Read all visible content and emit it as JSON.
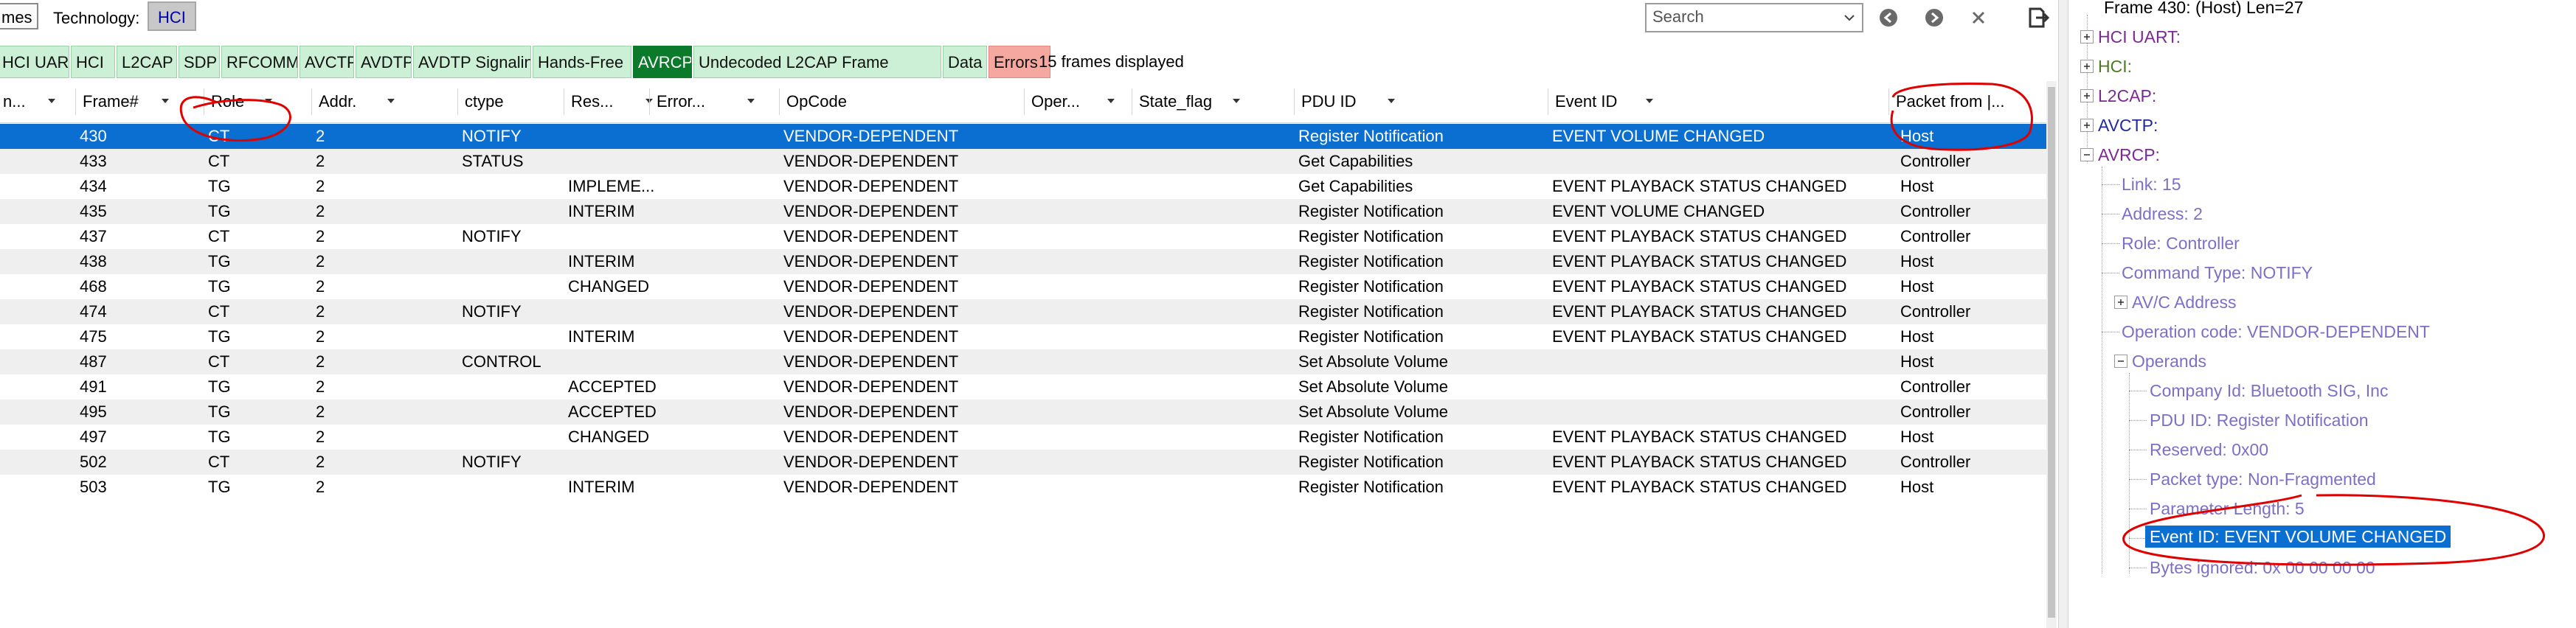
{
  "toolbar": {
    "frames_button": "mes",
    "technology_label": "Technology:",
    "technology_value": "HCI",
    "search_placeholder": "Search",
    "icons": [
      "back-arrow-icon",
      "forward-arrow-icon",
      "close-icon",
      "export-icon"
    ]
  },
  "filter_tabs": {
    "tabs": [
      "HCI UART",
      "HCI",
      "L2CAP",
      "SDP",
      "RFCOMM",
      "AVCTP",
      "AVDTP",
      "AVDTP Signaling",
      "Hands-Free",
      "AVRCP",
      "Undecoded L2CAP Frame",
      "Data",
      "Errors"
    ],
    "active_tab": "AVRCP",
    "frames_displayed": "15 frames displayed"
  },
  "table": {
    "columns": [
      "n...",
      "Frame#",
      "Role",
      "Addr.",
      "ctype",
      "Res...",
      "Error...",
      "OpCode",
      "Oper...",
      "State_flag",
      "PDU ID",
      "Event ID",
      "Packet from |..."
    ],
    "selected_frame": "430",
    "rows": [
      {
        "frame": "430",
        "role": "CT",
        "addr": "2",
        "ctype": "NOTIFY",
        "res": "",
        "opcode": "VENDOR-DEPENDENT",
        "pdu": "Register Notification",
        "event": "EVENT VOLUME CHANGED",
        "from": "Host"
      },
      {
        "frame": "433",
        "role": "CT",
        "addr": "2",
        "ctype": "STATUS",
        "res": "",
        "opcode": "VENDOR-DEPENDENT",
        "pdu": "Get Capabilities",
        "event": "",
        "from": "Controller"
      },
      {
        "frame": "434",
        "role": "TG",
        "addr": "2",
        "ctype": "",
        "res": "IMPLEME...",
        "opcode": "VENDOR-DEPENDENT",
        "pdu": "Get Capabilities",
        "event": "EVENT PLAYBACK STATUS CHANGED",
        "from": "Host"
      },
      {
        "frame": "435",
        "role": "TG",
        "addr": "2",
        "ctype": "",
        "res": "INTERIM",
        "opcode": "VENDOR-DEPENDENT",
        "pdu": "Register Notification",
        "event": "EVENT VOLUME CHANGED",
        "from": "Controller"
      },
      {
        "frame": "437",
        "role": "CT",
        "addr": "2",
        "ctype": "NOTIFY",
        "res": "",
        "opcode": "VENDOR-DEPENDENT",
        "pdu": "Register Notification",
        "event": "EVENT PLAYBACK STATUS CHANGED",
        "from": "Controller"
      },
      {
        "frame": "438",
        "role": "TG",
        "addr": "2",
        "ctype": "",
        "res": "INTERIM",
        "opcode": "VENDOR-DEPENDENT",
        "pdu": "Register Notification",
        "event": "EVENT PLAYBACK STATUS CHANGED",
        "from": "Host"
      },
      {
        "frame": "468",
        "role": "TG",
        "addr": "2",
        "ctype": "",
        "res": "CHANGED",
        "opcode": "VENDOR-DEPENDENT",
        "pdu": "Register Notification",
        "event": "EVENT PLAYBACK STATUS CHANGED",
        "from": "Host"
      },
      {
        "frame": "474",
        "role": "CT",
        "addr": "2",
        "ctype": "NOTIFY",
        "res": "",
        "opcode": "VENDOR-DEPENDENT",
        "pdu": "Register Notification",
        "event": "EVENT PLAYBACK STATUS CHANGED",
        "from": "Controller"
      },
      {
        "frame": "475",
        "role": "TG",
        "addr": "2",
        "ctype": "",
        "res": "INTERIM",
        "opcode": "VENDOR-DEPENDENT",
        "pdu": "Register Notification",
        "event": "EVENT PLAYBACK STATUS CHANGED",
        "from": "Host"
      },
      {
        "frame": "487",
        "role": "CT",
        "addr": "2",
        "ctype": "CONTROL",
        "res": "",
        "opcode": "VENDOR-DEPENDENT",
        "pdu": "Set Absolute Volume",
        "event": "",
        "from": "Host"
      },
      {
        "frame": "491",
        "role": "TG",
        "addr": "2",
        "ctype": "",
        "res": "ACCEPTED",
        "opcode": "VENDOR-DEPENDENT",
        "pdu": "Set Absolute Volume",
        "event": "",
        "from": "Controller"
      },
      {
        "frame": "495",
        "role": "TG",
        "addr": "2",
        "ctype": "",
        "res": "ACCEPTED",
        "opcode": "VENDOR-DEPENDENT",
        "pdu": "Set Absolute Volume",
        "event": "",
        "from": "Controller"
      },
      {
        "frame": "497",
        "role": "TG",
        "addr": "2",
        "ctype": "",
        "res": "CHANGED",
        "opcode": "VENDOR-DEPENDENT",
        "pdu": "Register Notification",
        "event": "EVENT PLAYBACK STATUS CHANGED",
        "from": "Host"
      },
      {
        "frame": "502",
        "role": "CT",
        "addr": "2",
        "ctype": "NOTIFY",
        "res": "",
        "opcode": "VENDOR-DEPENDENT",
        "pdu": "Register Notification",
        "event": "EVENT PLAYBACK STATUS CHANGED",
        "from": "Controller"
      },
      {
        "frame": "503",
        "role": "TG",
        "addr": "2",
        "ctype": "",
        "res": "INTERIM",
        "opcode": "VENDOR-DEPENDENT",
        "pdu": "Register Notification",
        "event": "EVENT PLAYBACK STATUS CHANGED",
        "from": "Host"
      }
    ]
  },
  "detail_tree": {
    "frame_title": "Frame 430: (Host) Len=27",
    "nodes": {
      "hci_uart": "HCI UART:",
      "hci": "HCI:",
      "l2cap": "L2CAP:",
      "avctp": "AVCTP:",
      "avrcp": "AVRCP:",
      "link": "Link: 15",
      "address": "Address: 2",
      "role": "Role: Controller",
      "command_type": "Command Type: NOTIFY",
      "av_c_address": "AV/C Address",
      "operation_code": "Operation code: VENDOR-DEPENDENT",
      "operands": "Operands",
      "company_id": "Company Id: Bluetooth SIG, Inc",
      "pdu_id": "PDU ID: Register Notification",
      "reserved": "Reserved: 0x00",
      "packet_type": "Packet type: Non-Fragmented",
      "parameter_length": "Parameter Length: 5",
      "event_id": "Event ID: EVENT VOLUME CHANGED",
      "bytes_ignored": "Bytes ignored: 0x 00 00 00 00"
    },
    "selected_node": "event_id"
  },
  "colors": {
    "selection": "#0a6fd0",
    "active_tab": "#0b7a2a",
    "tab_bg": "#ccf0d6",
    "errors_tab": "#f5a8a0",
    "annotation": "#e00000",
    "protocol_purple": "#7b2a92",
    "protocol_green": "#4c7a1e",
    "protocol_blue": "#222a99",
    "leaf_purple": "#7d6fc4"
  }
}
